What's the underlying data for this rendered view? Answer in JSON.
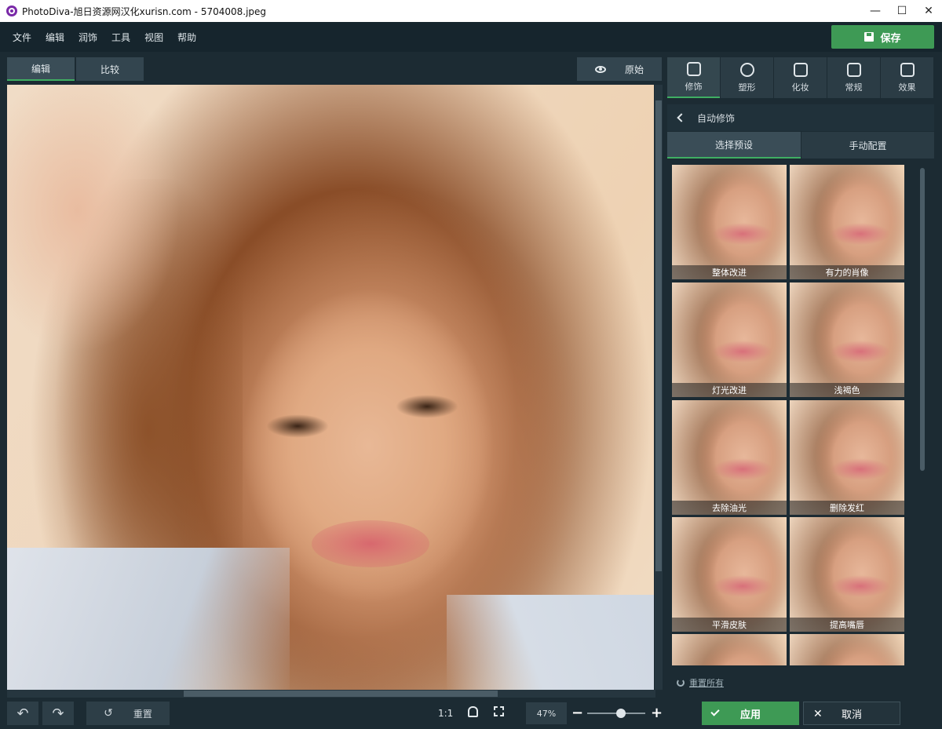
{
  "window": {
    "title": "PhotoDiva-旭日资源网汉化xurisn.com - 5704008.jpeg",
    "minimize": "—",
    "maximize": "☐",
    "close": "✕"
  },
  "menu": [
    "文件",
    "编辑",
    "润饰",
    "工具",
    "视图",
    "帮助"
  ],
  "save_label": "保存",
  "view_tabs": {
    "edit": "编辑",
    "compare": "比较",
    "original": "原始"
  },
  "right_tabs": [
    "修饰",
    "塑形",
    "化妆",
    "常规",
    "效果"
  ],
  "panel_header": "自动修饰",
  "sub_tabs": {
    "presets": "选择预设",
    "manual": "手动配置"
  },
  "presets": [
    "整体改进",
    "有力的肖像",
    "灯光改进",
    "浅褐色",
    "去除油光",
    "删除发红",
    "平滑皮肤",
    "提高嘴唇"
  ],
  "reset_all": "重置所有",
  "apply_label": "应用",
  "cancel_label": "取消",
  "bottom": {
    "undo": "↶",
    "redo": "↷",
    "reset_label": "重置",
    "one_to_one": "1:1",
    "zoom": "47%",
    "zoom_level": 0.47,
    "minus": "−",
    "plus": "+"
  },
  "colors": {
    "accent": "#3e9a55",
    "background": "#1c2b33",
    "panel": "#2b3c45"
  }
}
